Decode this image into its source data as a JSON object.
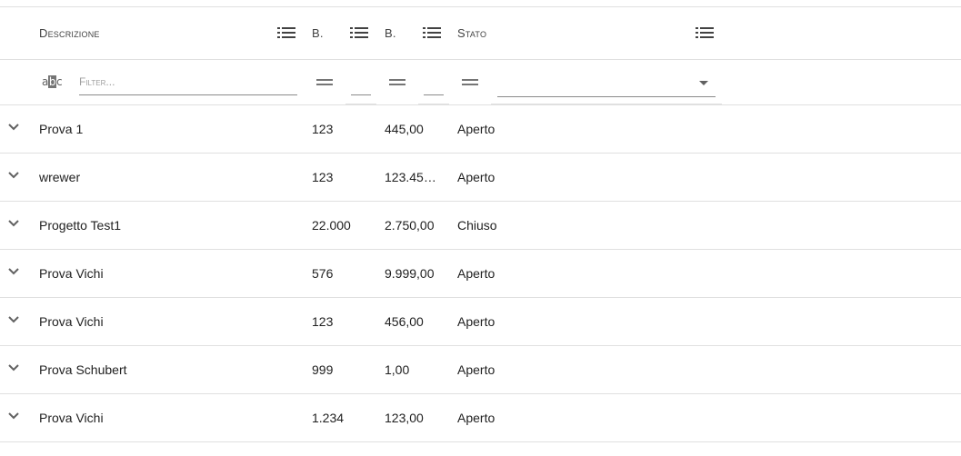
{
  "header": {
    "columns": [
      {
        "label": "Descrizione"
      },
      {
        "label": "B."
      },
      {
        "label": "B."
      },
      {
        "label": "Stato"
      }
    ]
  },
  "filter": {
    "placeholder": "Filter..."
  },
  "rows": [
    {
      "descrizione": "Prova 1",
      "b1": "123",
      "b2": "445,00",
      "stato": "Aperto"
    },
    {
      "descrizione": "wrewer",
      "b1": "123",
      "b2": "123.45…",
      "stato": "Aperto"
    },
    {
      "descrizione": "Progetto Test1",
      "b1": "22.000",
      "b2": "2.750,00",
      "stato": "Chiuso"
    },
    {
      "descrizione": "Prova Vichi",
      "b1": "576",
      "b2": "9.999,00",
      "stato": "Aperto"
    },
    {
      "descrizione": "Prova Vichi",
      "b1": "123",
      "b2": "456,00",
      "stato": "Aperto"
    },
    {
      "descrizione": "Prova Schubert",
      "b1": "999",
      "b2": "1,00",
      "stato": "Aperto"
    },
    {
      "descrizione": "Prova Vichi",
      "b1": "1.234",
      "b2": "123,00",
      "stato": "Aperto"
    }
  ],
  "icons": {
    "column_menu": "list-icon",
    "text_filter_type": "abc-icon",
    "equals_operator": "equals-icon",
    "select_caret": "caret-down-icon",
    "row_expand": "chevron-down-icon"
  },
  "colors": {
    "text": "#212121",
    "header_text": "#424242",
    "icon": "#616161",
    "divider": "#e0e0e0"
  }
}
